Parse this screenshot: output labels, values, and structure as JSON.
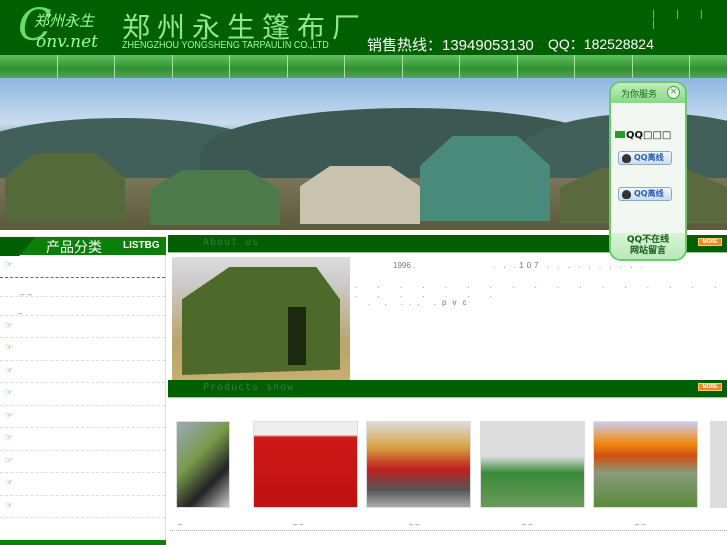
{
  "header": {
    "logo_cn": "郑州永生",
    "logo_letter": "C",
    "logo_net": "onv.net",
    "company_cn": "郑州永生篷布厂",
    "company_en": "ZHENGZHOU YONGSHENG TARPAULIN CO.,LTD",
    "hotline": "销售热线：13949053130",
    "qq": "QQ：182528824",
    "toplinks": "| | | |"
  },
  "sidebar": {
    "title": "产品分类",
    "title_en": "LISTBG",
    "hand_icon": "☞",
    "dash": "_ _",
    "dash2": "_"
  },
  "about": {
    "title": "About us",
    "more": "MORE",
    "line1a": "1996 .",
    "line1b": ". . .107 . . . . . . . . . .",
    "line2": ". . . . . . . . . . . . . . . . . . . . . . . .",
    "line3": ". . ... .pvc"
  },
  "products": {
    "title": "Products show",
    "more": "MORE",
    "captions": [
      "_",
      "_ _",
      "_ _",
      "_ _",
      "_ _"
    ]
  },
  "qq_panel": {
    "title": "为你服务",
    "close": "×",
    "group": "QQ□□□",
    "btn1": "QQ离线",
    "btn2": "QQ离线",
    "footer1": "QQ不在线",
    "footer2": "网站留言"
  }
}
